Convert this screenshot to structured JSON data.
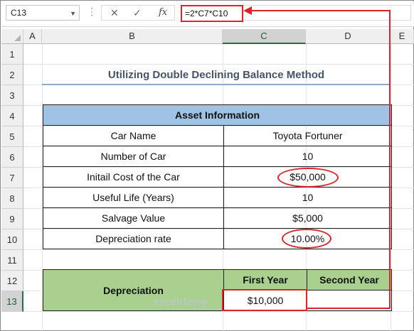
{
  "formula_bar": {
    "name_box": "C13",
    "fx_label": "fx",
    "formula": "=2*C7*C10",
    "cancel_icon": "close-icon",
    "enter_icon": "check-icon"
  },
  "columns": [
    "A",
    "B",
    "C",
    "D",
    "E"
  ],
  "rows": [
    "1",
    "2",
    "3",
    "4",
    "5",
    "6",
    "7",
    "8",
    "9",
    "10",
    "11",
    "12",
    "13"
  ],
  "title": "Utilizing Double Declining Balance Method",
  "asset_table": {
    "header": "Asset Information",
    "rows": [
      {
        "label": "Car Name",
        "value": "Toyota Fortuner"
      },
      {
        "label": "Number of Car",
        "value": "10"
      },
      {
        "label": "Initail Cost of the Car",
        "value": "$50,000"
      },
      {
        "label": "Useful Life (Years)",
        "value": "10"
      },
      {
        "label": "Salvage Value",
        "value": "$5,000"
      },
      {
        "label": "Depreciation rate",
        "value": "10.00%"
      }
    ]
  },
  "depreciation_table": {
    "label": "Depreciation",
    "first_year_header": "First Year",
    "second_year_header": "Second Year",
    "first_year_value": "$10,000",
    "second_year_value": ""
  },
  "watermark": {
    "brand": "exceldemy",
    "tagline": "EXCEL · DATA · BI"
  },
  "colors": {
    "highlight": "#d9252b",
    "asset_header": "#9fc3e4",
    "dep_fill": "#a9d08e",
    "selected_header": "#217346"
  }
}
